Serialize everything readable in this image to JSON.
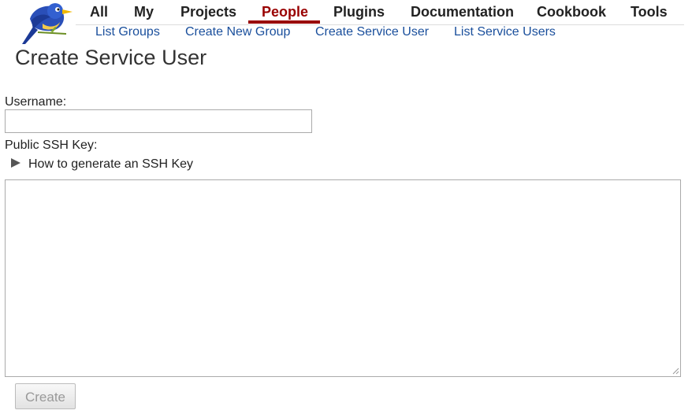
{
  "nav": {
    "tabs": [
      {
        "label": "All",
        "active": false
      },
      {
        "label": "My",
        "active": false
      },
      {
        "label": "Projects",
        "active": false
      },
      {
        "label": "People",
        "active": true
      },
      {
        "label": "Plugins",
        "active": false
      },
      {
        "label": "Documentation",
        "active": false
      },
      {
        "label": "Cookbook",
        "active": false
      },
      {
        "label": "Tools",
        "active": false
      }
    ],
    "subtabs": [
      {
        "label": "List Groups"
      },
      {
        "label": "Create New Group"
      },
      {
        "label": "Create Service User"
      },
      {
        "label": "List Service Users"
      }
    ]
  },
  "page": {
    "title": "Create Service User"
  },
  "form": {
    "username_label": "Username:",
    "username_value": "",
    "ssh_key_label": "Public SSH Key:",
    "ssh_help_label": "How to generate an SSH Key",
    "ssh_key_value": "",
    "create_label": "Create"
  },
  "logo": {
    "icon": "bird-logo-icon"
  },
  "colors": {
    "active_tab": "#990000",
    "link": "#1a4f9c",
    "text": "#222222",
    "disabled_button_text": "#999999"
  }
}
